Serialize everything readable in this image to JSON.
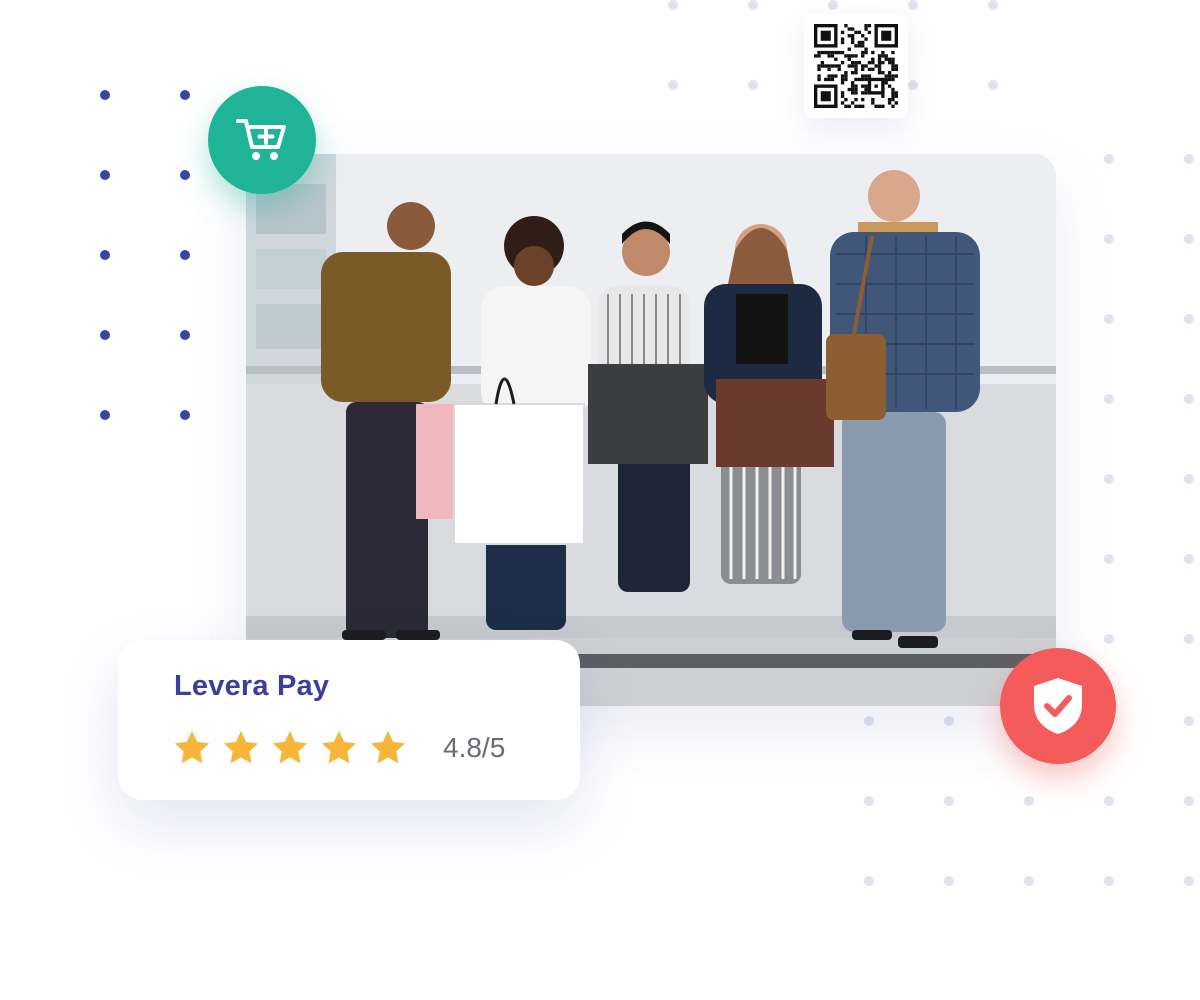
{
  "brand": {
    "name": "Levera Pay"
  },
  "rating": {
    "score_text": "4.8/5",
    "stars_filled": 5,
    "stars_total": 5
  },
  "icons": {
    "cart": "cart-plus-icon",
    "shield": "shield-check-icon",
    "qr": "qr-code-icon",
    "star": "star-icon"
  },
  "colors": {
    "brand_text": "#3a3f9e",
    "cart_badge": "#1fb497",
    "shield_badge": "#f45b5b",
    "star": "#f6b63a",
    "dots_left": "#3b45a8",
    "dots_light": "#dfe2f4"
  }
}
